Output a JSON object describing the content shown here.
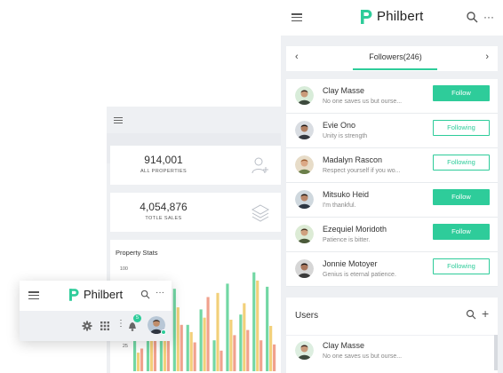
{
  "app": {
    "name": "Philbert",
    "accent_color": "#2ecc9a"
  },
  "dashboard": {
    "stats": [
      {
        "value": "914,001",
        "label": "ALL PROPERTIES",
        "icon": "user-add-icon"
      },
      {
        "value": "4,054,876",
        "label": "TOTLE SALES",
        "icon": "layers-icon"
      }
    ],
    "chart_title": "Property Stats"
  },
  "chart_data": {
    "type": "bar",
    "title": "Property Stats",
    "yticks": [
      "100",
      "25"
    ],
    "ylim": [
      0,
      100
    ],
    "series_colors": [
      "#72d7a4",
      "#f2d07a",
      "#f1a18d"
    ],
    "values": [
      [
        35,
        18,
        22
      ],
      [
        68,
        55,
        40
      ],
      [
        50,
        70,
        30
      ],
      [
        80,
        62,
        45
      ],
      [
        45,
        38,
        28
      ],
      [
        60,
        52,
        72
      ],
      [
        30,
        76,
        20
      ],
      [
        85,
        50,
        35
      ],
      [
        55,
        66,
        40
      ],
      [
        96,
        88,
        30
      ],
      [
        82,
        44,
        26
      ]
    ]
  },
  "followers_panel": {
    "tab_label": "Followers(246)",
    "prev_icon": "chevron-left-icon",
    "next_icon": "chevron-right-icon",
    "rows": [
      {
        "name": "Clay Masse",
        "status": "No one saves us but ourse...",
        "button": "Follow",
        "active": true
      },
      {
        "name": "Evie Ono",
        "status": "Unity is strength",
        "button": "Following",
        "active": false
      },
      {
        "name": "Madalyn Rascon",
        "status": "Respect yourself if you wo...",
        "button": "Following",
        "active": false
      },
      {
        "name": "Mitsuko Heid",
        "status": "I'm thankful.",
        "button": "Follow",
        "active": true
      },
      {
        "name": "Ezequiel Moridoth",
        "status": "Patience is bitter.",
        "button": "Follow",
        "active": true
      },
      {
        "name": "Jonnie Motoyer",
        "status": "Genius is eternal patience.",
        "button": "Following",
        "active": false
      }
    ]
  },
  "users_panel": {
    "title": "Users",
    "add_label": "+",
    "row": {
      "name": "Clay Masse",
      "status": "No one saves us but ourse..."
    }
  },
  "mini_header": {
    "notification_count": "5",
    "more_label": "···",
    "vdots_label": "⋮"
  }
}
